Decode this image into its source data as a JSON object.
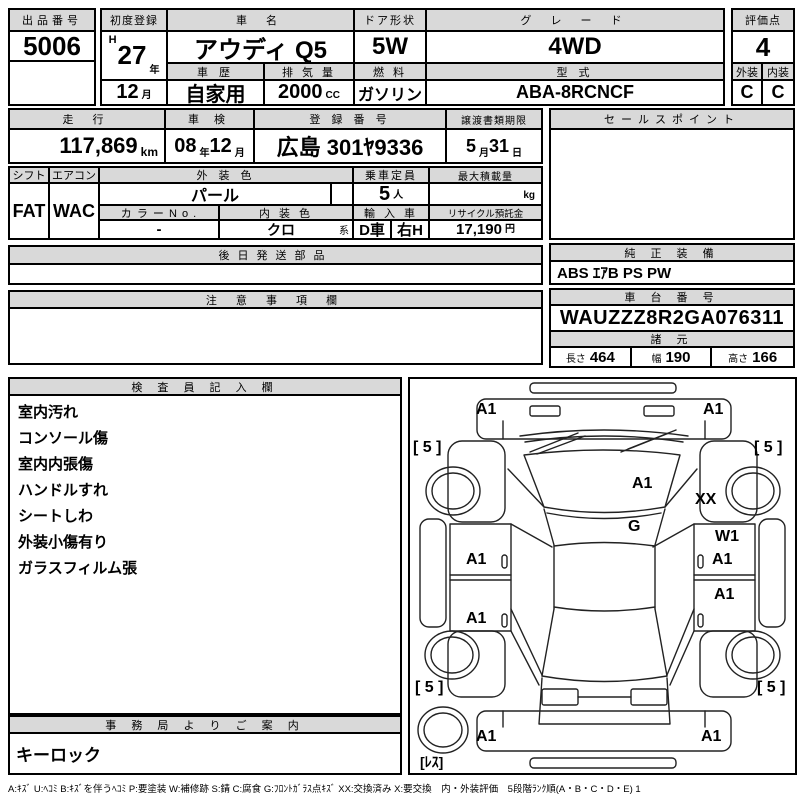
{
  "colors": {
    "header_bg": "#d9d9d9",
    "border": "#000000"
  },
  "top": {
    "auction_no_label": "出品番号",
    "auction_no": "5006",
    "first_reg_label": "初度登録",
    "first_reg_era": "H",
    "first_reg_year": "27",
    "first_reg_year_unit": "年",
    "first_reg_month": "12",
    "first_reg_month_unit": "月",
    "name_label": "車 名",
    "name": "アウディ Q5",
    "history_label": "車 歴",
    "history": "自家用",
    "disp_label": "排 気 量",
    "disp": "2000",
    "disp_unit": "CC",
    "door_label": "ドア形状",
    "door": "5W",
    "fuel_label": "燃 料",
    "fuel": "ガソリン",
    "grade_label": "グ レ ー ド",
    "grade": "4WD",
    "model_label": "型 式",
    "model": "ABA-8RCNCF",
    "score_label": "評価点",
    "score": "4",
    "ext_label": "外装",
    "ext": "C",
    "int_label": "内装",
    "int": "C"
  },
  "reg": {
    "mileage_label": "走 行",
    "mileage": "117,869",
    "mileage_unit": "km",
    "shaken_label": "車 検",
    "shaken_year": "08",
    "shaken_year_unit": "年",
    "shaken_month": "12",
    "shaken_month_unit": "月",
    "plate_label": "登 録 番 号",
    "plate": "広島 301ﾔ9336",
    "deadline_label": "譲渡書類期限",
    "deadline_month": "5",
    "deadline_month_unit": "月",
    "deadline_day": "31",
    "deadline_day_unit": "日"
  },
  "equip": {
    "shift_label": "シフト",
    "shift": "FAT",
    "ac_label": "エアコン",
    "ac": "WAC",
    "color_label": "外 装 色",
    "color": "パール",
    "capacity_label": "乗車定員",
    "capacity": "5",
    "capacity_unit": "人",
    "payload_label": "最大積載量",
    "payload_unit": "kg",
    "colorno_label": "カ ラ ー N o .",
    "colorno": "-",
    "interior_label": "内 装 色",
    "interior": "クロ",
    "interior_suffix": "系",
    "import_label": "輸 入 車",
    "import_type": "D車",
    "handle": "右H",
    "recycle_label": "リサイクル預託金",
    "recycle": "17,190",
    "recycle_unit": "円"
  },
  "sales_point": {
    "label": "セールスポイント",
    "value": ""
  },
  "later_parts": {
    "label": "後日発送部品",
    "value": ""
  },
  "oem_equip": {
    "label": "純 正 装 備",
    "value": "ABS ｴｱB PS PW"
  },
  "caution": {
    "label": "注 意 事 項 欄",
    "value": ""
  },
  "vin": {
    "label": "車 台 番 号",
    "value": "WAUZZZ8R2GA076311",
    "spec_label": "諸 元",
    "length_label": "長さ",
    "length": "464",
    "width_label": "幅",
    "width": "190",
    "height_label": "高さ",
    "height": "166"
  },
  "inspector": {
    "label": "検 査 員 記 入 欄",
    "notes": [
      "室内汚れ",
      "コンソール傷",
      "室内内張傷",
      "ハンドルすれ",
      "シートしわ",
      "外装小傷有り",
      "ガラスフィルム張"
    ]
  },
  "office": {
    "label": "事 務 局 よ り ご 案 内",
    "value": "キーロック"
  },
  "diagram": {
    "labels": [
      "A1",
      "A1",
      "[ 5 ]",
      "[ 5 ]",
      "A1",
      "XX",
      "G",
      "W1",
      "A1",
      "A1",
      "A1",
      "A1",
      "[ 5 ]",
      "[ 5 ]",
      "A1",
      "A1",
      "[ﾚｽ]"
    ]
  },
  "legend": "A:ｷｽﾞ U:ﾍｺﾐ B:ｷｽﾞを伴うﾍｺﾐ P:要塗装 W:補修跡 S:錆 C:腐食 G:ﾌﾛﾝﾄｶﾞﾗｽ点ｷｽﾞ XX:交換済み X:要交換　内・外装評価　5段階ﾗﾝｸ順(A・B・C・D・E) 1"
}
